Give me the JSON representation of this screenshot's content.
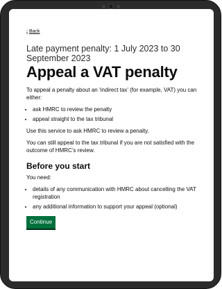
{
  "nav": {
    "back_label": "Back"
  },
  "caption": "Late payment penalty: 1 July 2023 to 30 September 2023",
  "title": "Appeal a VAT penalty",
  "intro": "To appeal a penalty about an ‘indirect tax’ (for example, VAT) you can either:",
  "options": [
    "ask HMRC to review the penalty",
    "appeal straight to the tax tribunal"
  ],
  "service_text": "Use this service to ask HMRC to review a penalty.",
  "tribunal_text": "You can still appeal to the tax tribunal if you are not satisfied with the outcome of HMRC’s review.",
  "before_heading": "Before you start",
  "need_label": "You need:",
  "needs": [
    "details of any communication with HMRC about cancelling the VAT registration",
    "any additional information to support your appeal (optional)"
  ],
  "continue_label": "Continue"
}
